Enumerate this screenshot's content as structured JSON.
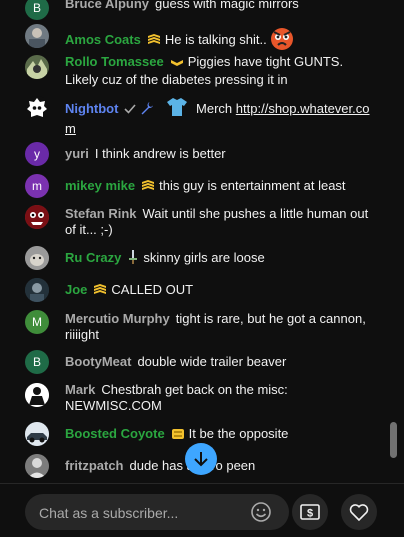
{
  "messages": [
    {
      "author": "Bruce Alpuny",
      "text": "guess with magic mirrors",
      "avatar_letter": "B",
      "avatar_color": "#1f6b47",
      "author_color": "#aaaaaa"
    },
    {
      "author": "Amos Coats",
      "text": "He is talking shit..",
      "avatar_color": "#707a82",
      "author_color": "#2ba640",
      "badge": "member-badge-icon",
      "trailing_emoji": "angry-face-emoji"
    },
    {
      "author": "Rollo Tomassee",
      "text": "Piggies have tight GUNTS. Likely cuz of the diabetes pressing it in",
      "avatar_color": "#5a6b4a",
      "author_color": "#2ba640",
      "badge": "member-badge-icon"
    },
    {
      "author": "Nightbot",
      "text": "Merch",
      "link": "http://shop.whatever.com",
      "avatar_color": "#4a63ff",
      "author_color": "#5e84f1",
      "badge": "moderator-wrench-icon"
    },
    {
      "author": "yuri",
      "text": "I think andrew is better",
      "avatar_letter": "y",
      "avatar_color": "#6a2aa8",
      "author_color": "#aaaaaa"
    },
    {
      "author": "mikey mike",
      "text": "this guy is entertainment at least",
      "avatar_letter": "m",
      "avatar_color": "#7b32b0",
      "author_color": "#2ba640",
      "badge": "member-badge-icon"
    },
    {
      "author": "Stefan Rink",
      "text": "Wait until she pushes a little human out of it... ;-)",
      "avatar_color": "#b3262b",
      "author_color": "#aaaaaa"
    },
    {
      "author": "Ru Crazy",
      "text": "skinny girls are loose",
      "avatar_color": "#8c8c8c",
      "author_color": "#2ba640",
      "badge": "member-sword-badge-icon"
    },
    {
      "author": "Joe",
      "text": "CALLED OUT",
      "avatar_color": "#2b3a44",
      "author_color": "#2ba640",
      "badge": "member-badge-icon"
    },
    {
      "author": "Mercutio Murphy",
      "text": "tight is rare, but he got a cannon, riiiight",
      "avatar_letter": "M",
      "avatar_color": "#3f8d3a",
      "author_color": "#aaaaaa"
    },
    {
      "author": "BootyMeat",
      "text": "double wide trailer beaver",
      "avatar_letter": "B",
      "avatar_color": "#1f6b47",
      "author_color": "#aaaaaa"
    },
    {
      "author": "Mark",
      "text": "Chestbrah get back on the misc: NEWMISC.COM",
      "avatar_color": "#1c1c1c",
      "author_color": "#aaaaaa"
    },
    {
      "author": "Boosted Coyote",
      "text": "It be the opposite",
      "avatar_color": "#5b6b7a",
      "author_color": "#2ba640",
      "badge": "member-badge-icon"
    },
    {
      "author": "fritzpatch",
      "text": "dude has a zero peen",
      "avatar_color": "#6a6a6a",
      "author_color": "#aaaaaa"
    }
  ],
  "input": {
    "placeholder": "Chat as a subscriber..."
  },
  "colors": {
    "accent": "#3ea6ff",
    "member": "#2ba640",
    "moderator": "#5e84f1"
  }
}
